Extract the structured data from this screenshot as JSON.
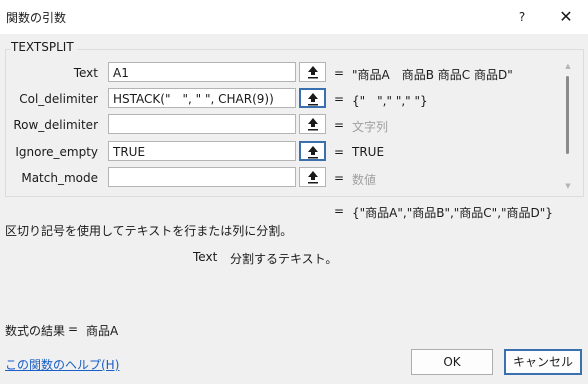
{
  "window": {
    "title": "関数の引数",
    "help_label": "?",
    "close_label": "✕"
  },
  "function_name": "TEXTSPLIT",
  "arguments": [
    {
      "label": "Text",
      "value": "A1",
      "equals": "=",
      "result": "\"商品A　商品B 商品C 商品D\"",
      "result_muted": false
    },
    {
      "label": "Col_delimiter",
      "value": "HSTACK(\"　\", \" \", CHAR(9))",
      "equals": "=",
      "result": "{\"　\",\" \",\"\t\"}",
      "result_muted": false
    },
    {
      "label": "Row_delimiter",
      "value": "",
      "equals": "=",
      "result": "文字列",
      "result_muted": true
    },
    {
      "label": "Ignore_empty",
      "value": "TRUE",
      "equals": "=",
      "result": "TRUE",
      "result_muted": false
    },
    {
      "label": "Match_mode",
      "value": "",
      "equals": "=",
      "result": "数値",
      "result_muted": true
    }
  ],
  "overall": {
    "equals": "=",
    "value": "{\"商品A\",\"商品B\",\"商品C\",\"商品D\"}"
  },
  "description": "区切り記号を使用してテキストを行または列に分割。",
  "arg_description": {
    "name": "Text",
    "text": "分割するテキスト。"
  },
  "result": {
    "label": "数式の結果",
    "equals": "=",
    "value": "商品A"
  },
  "help_link": "この関数のヘルプ(H)",
  "buttons": {
    "ok": "OK",
    "cancel": "キャンセル"
  },
  "icons": {
    "ref": "collapse-dialog-arrow-icon"
  }
}
